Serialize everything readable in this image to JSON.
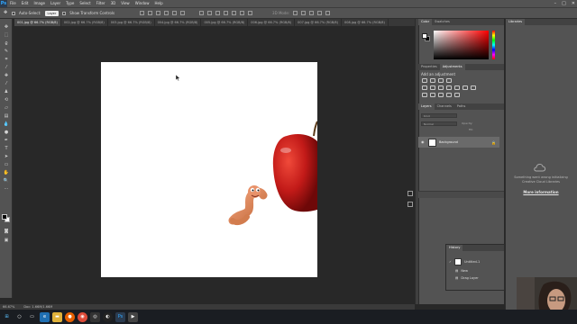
{
  "app": {
    "logo": "Ps"
  },
  "menu": [
    "File",
    "Edit",
    "Image",
    "Layer",
    "Type",
    "Select",
    "Filter",
    "3D",
    "View",
    "Window",
    "Help"
  ],
  "options": {
    "auto_select": "Auto-Select:",
    "layer_select": "Layer",
    "show_transform": "Show Transform Controls"
  },
  "tabs": [
    {
      "label": "001.jpg @ 66.7% (RGB/8)"
    },
    {
      "label": "002.jpg @ 66.7% (RGB/8)"
    },
    {
      "label": "003.jpg @ 66.7% (RGB/8)"
    },
    {
      "label": "004.jpg @ 66.7% (RGB/8)"
    },
    {
      "label": "005.jpg @ 66.7% (RGB/8)"
    },
    {
      "label": "006.jpg @ 66.7% (RGB/8)"
    },
    {
      "label": "007.jpg @ 66.7% (RGB/8)"
    },
    {
      "label": "008.jpg @ 66.7% (RGB/8)"
    }
  ],
  "status": {
    "zoom": "66.67%",
    "doc": "Doc: 1.66M/1.66M"
  },
  "color_panel": {
    "tabs": [
      "Color",
      "Swatches"
    ]
  },
  "adjust_panel": {
    "tabs": [
      "Properties",
      "Adjustments"
    ],
    "title": "Add an adjustment"
  },
  "layers_panel": {
    "tabs": [
      "Layers",
      "Channels",
      "Paths"
    ],
    "kind": "Kind",
    "normal": "Normal",
    "opacity": "Opacity:",
    "fill": "Fill:",
    "layer_name": "Background"
  },
  "libraries": {
    "title": "Libraries",
    "message": "Something went wrong initializing Creative Cloud Libraries",
    "link": "More information"
  },
  "history": {
    "title": "History",
    "items": [
      "Untitled-1",
      "New",
      "Drag Layer"
    ]
  },
  "colors": {
    "accent": "#31a8ff",
    "panel": "#535353",
    "workspace": "#282828",
    "apple": "#c21a18",
    "worm": "#e08a5c"
  }
}
